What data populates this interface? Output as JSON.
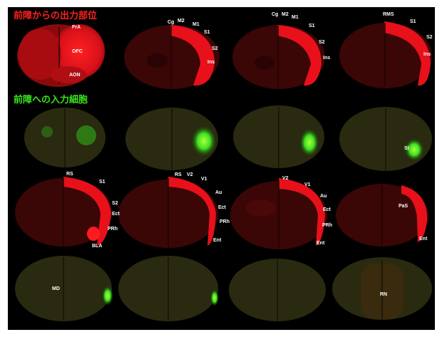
{
  "headings": {
    "output": "前障からの出力部位",
    "input": "前障への入力細胞"
  },
  "colors": {
    "background": "#000000",
    "output_red": "#e8101a",
    "input_green": "#39e61a",
    "tissue_dark_red": "#3a0a06",
    "tissue_dark_green": "#2a2a10"
  },
  "row1_labels": [
    "FrA",
    "OFC",
    "AON",
    "Cg",
    "M2",
    "M1",
    "S1",
    "S2",
    "Ins",
    "Cg",
    "M2",
    "M1",
    "S1",
    "S2",
    "Ins",
    "RMS",
    "S1",
    "S2",
    "Ins"
  ],
  "row2_labels": [
    "SI"
  ],
  "row3_labels": [
    "RS",
    "S1",
    "S2",
    "Ect",
    "PRh",
    "BLA",
    "RS",
    "V2",
    "V1",
    "Au",
    "Ect",
    "PRh",
    "Ent",
    "V2",
    "V1",
    "Au",
    "Ect",
    "PRh",
    "Ent",
    "PaS",
    "Ent"
  ],
  "row4_labels": [
    "MD",
    "RN"
  ]
}
